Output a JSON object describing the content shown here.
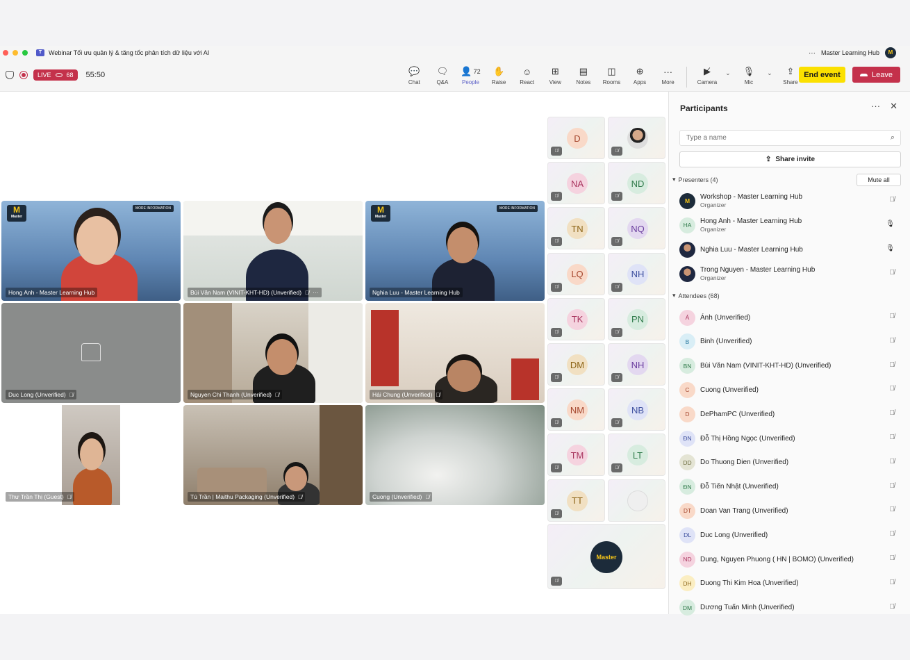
{
  "window": {
    "title": "Webinar Tối ưu quản lý & tăng tốc phân tích dữ liệu với AI",
    "org": "Master Learning Hub",
    "org_avatar": "M",
    "more": "···"
  },
  "toolbar": {
    "live_label": "LIVE",
    "viewers": "68",
    "timer": "55:50",
    "people_count": "72",
    "tools": [
      {
        "label": "Chat",
        "icon": "chat-icon"
      },
      {
        "label": "Q&A",
        "icon": "qa-icon"
      },
      {
        "label": "People",
        "icon": "people-icon"
      },
      {
        "label": "Raise",
        "icon": "hand-icon"
      },
      {
        "label": "React",
        "icon": "smile-icon"
      },
      {
        "label": "View",
        "icon": "grid-icon"
      },
      {
        "label": "Notes",
        "icon": "notes-icon"
      },
      {
        "label": "Rooms",
        "icon": "rooms-icon"
      },
      {
        "label": "Apps",
        "icon": "apps-icon"
      },
      {
        "label": "More",
        "icon": "more-icon"
      }
    ],
    "camera_label": "Camera",
    "mic_label": "Mic",
    "share_label": "Share",
    "end_event_label": "End event",
    "leave_label": "Leave"
  },
  "video_tiles": [
    {
      "name": "Hong Anh - Master Learning Hub",
      "muted": false
    },
    {
      "name": "Bùi Văn Nam (VINIT-KHT-HD) (Unverified)",
      "muted": true
    },
    {
      "name": "Nghia Luu - Master Learning Hub",
      "muted": false
    },
    {
      "name": "Duc Long (Unverified)",
      "muted": true
    },
    {
      "name": "Nguyen Chi Thanh (Unverified)",
      "muted": true
    },
    {
      "name": "Hải Chung (Unverified)",
      "muted": true
    },
    {
      "name": "Thư Trần Thị (Guest)",
      "muted": true
    },
    {
      "name": "Tú Trần | Maithu Packaging (Unverified)",
      "muted": true
    },
    {
      "name": "Cuong (Unverified)",
      "muted": true
    }
  ],
  "banner": {
    "logo_text": "M",
    "logo_sub": "Master",
    "more_info": "MORE INFORMATION"
  },
  "gallery": [
    {
      "initials": "D"
    },
    {
      "initials": ""
    },
    {
      "initials": "NA"
    },
    {
      "initials": "ND"
    },
    {
      "initials": "TN"
    },
    {
      "initials": "NQ"
    },
    {
      "initials": "LQ"
    },
    {
      "initials": "NH"
    },
    {
      "initials": "TK"
    },
    {
      "initials": "PN"
    },
    {
      "initials": "DM"
    },
    {
      "initials": "NH"
    },
    {
      "initials": "NM"
    },
    {
      "initials": "NB"
    },
    {
      "initials": "TM"
    },
    {
      "initials": "LT"
    },
    {
      "initials": "TT"
    },
    {
      "initials": ""
    }
  ],
  "gallery_bottom_logo": "Master",
  "participants": {
    "title": "Participants",
    "search_placeholder": "Type a name",
    "share_invite": "Share invite",
    "presenters_label": "Presenters (4)",
    "mute_all": "Mute all",
    "attendees_label": "Attendees (68)",
    "presenters": [
      {
        "name": "Workshop - Master Learning Hub",
        "role": "Organizer",
        "initials": "M",
        "mic": "off"
      },
      {
        "name": "Hong Anh - Master Learning Hub",
        "role": "Organizer",
        "initials": "HA",
        "mic": "on"
      },
      {
        "name": "Nghia Luu - Master Learning Hub",
        "role": "",
        "initials": "",
        "mic": "on"
      },
      {
        "name": "Trong Nguyen - Master Learning Hub",
        "role": "Organizer",
        "initials": "",
        "mic": "off"
      }
    ],
    "attendees": [
      {
        "name": "Ánh (Unverified)",
        "initials": "Á"
      },
      {
        "name": "Binh (Unverified)",
        "initials": "B"
      },
      {
        "name": "Bùi Văn Nam (VINIT-KHT-HD) (Unverified)",
        "initials": "BN"
      },
      {
        "name": "Cuong (Unverified)",
        "initials": "C"
      },
      {
        "name": "DePhamPC (Unverified)",
        "initials": "D"
      },
      {
        "name": "Đỗ Thị Hồng Ngọc (Unverified)",
        "initials": "ĐN"
      },
      {
        "name": "Do Thuong Dien (Unverified)",
        "initials": "DD"
      },
      {
        "name": "Đỗ Tiến Nhật (Unverified)",
        "initials": "ĐN"
      },
      {
        "name": "Doan Van Trang (Unverified)",
        "initials": "DT"
      },
      {
        "name": "Duc Long (Unverified)",
        "initials": "DL"
      },
      {
        "name": "Dung, Nguyen Phuong ( HN | BOMO) (Unverified)",
        "initials": "ND"
      },
      {
        "name": "Duong Thi Kim Hoa (Unverified)",
        "initials": "DH"
      },
      {
        "name": "Dương Tuấn Minh (Unverified)",
        "initials": "DM"
      }
    ]
  }
}
